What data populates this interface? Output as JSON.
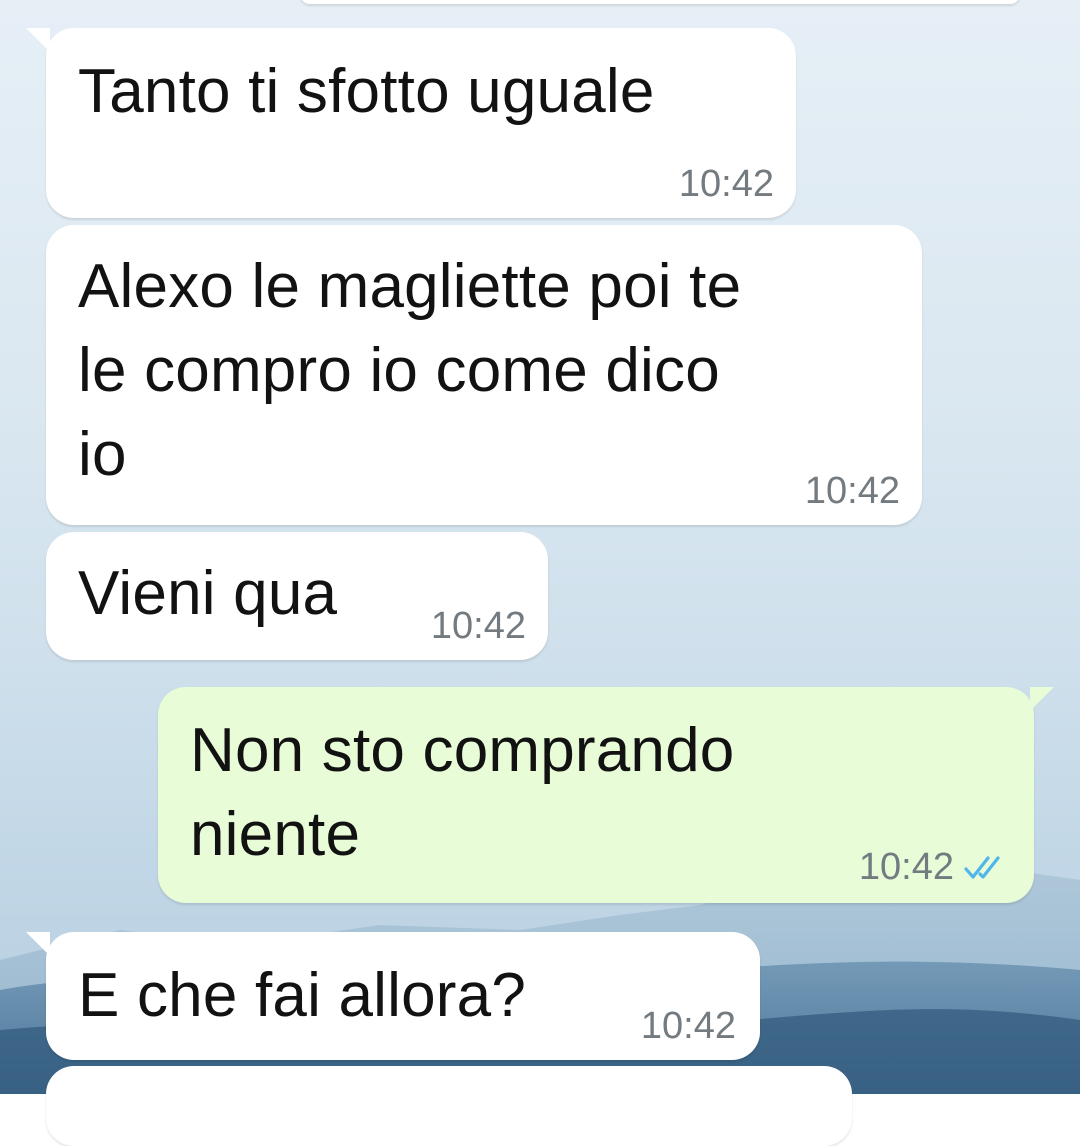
{
  "chat": {
    "messages": [
      {
        "direction": "incoming",
        "text": "Tanto ti sfotto uguale",
        "time": "10:42"
      },
      {
        "direction": "incoming",
        "text": "Alexo le magliette poi te\nle compro io come dico\nio",
        "time": "10:42"
      },
      {
        "direction": "incoming",
        "text": "Vieni qua",
        "time": "10:42"
      },
      {
        "direction": "outgoing",
        "text": "Non sto comprando\nniente",
        "time": "10:42",
        "status_icon": "double-check-read-icon"
      },
      {
        "direction": "incoming",
        "text": "E che fai allora?",
        "time": "10:42"
      }
    ]
  },
  "colors": {
    "incoming_bubble": "#ffffff",
    "outgoing_bubble": "#e8fcd8",
    "read_ticks": "#4fb6ec",
    "time_text": "#737b80"
  }
}
